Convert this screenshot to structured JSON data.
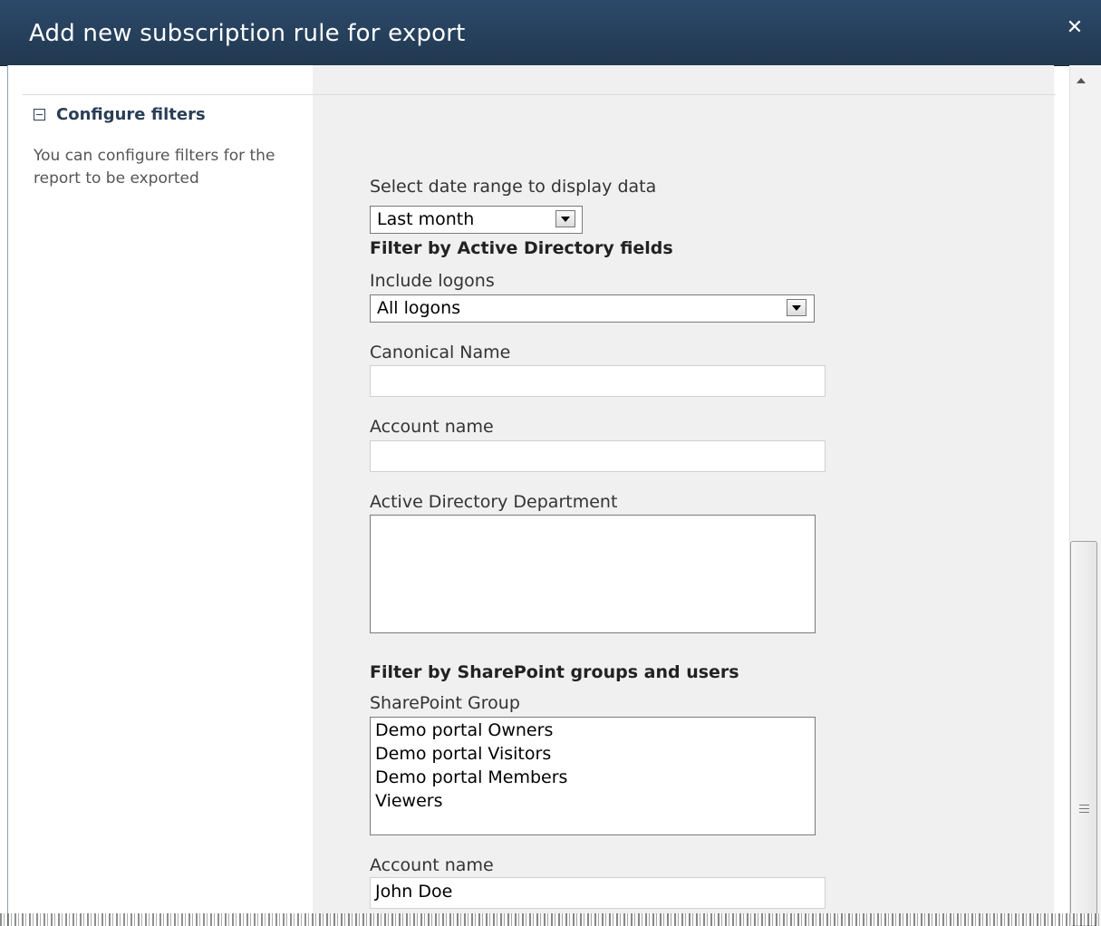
{
  "dialog": {
    "title": "Add new subscription rule for export",
    "close_symbol": "✕"
  },
  "section": {
    "title": "Configure filters",
    "description": "You can configure filters for the report to be exported"
  },
  "form": {
    "date_range_label": "Select date range to display data",
    "date_range_value": "Last month",
    "ad_header": "Filter by Active Directory fields",
    "include_logons_label": "Include logons",
    "include_logons_value": "All logons",
    "canonical_name_label": "Canonical Name",
    "canonical_name_value": "",
    "account_name_label": "Account name",
    "account_name_value": "",
    "department_label": "Active Directory Department",
    "department_options": [],
    "sp_header": "Filter by SharePoint groups and users",
    "sp_group_label": "SharePoint Group",
    "sp_group_options": [
      "Demo portal Owners",
      "Demo portal Visitors",
      "Demo portal Members",
      "Viewers"
    ],
    "sp_account_label": "Account name",
    "sp_account_value": "John Doe"
  },
  "colors": {
    "titlebar": "#21384f",
    "main_background": "#f0f0f0",
    "section_title": "#2a3e56"
  },
  "icons": [
    "close-icon",
    "collapse-icon",
    "dropdown-arrow-icon",
    "scroll-up-icon",
    "scroll-grip-icon"
  ]
}
